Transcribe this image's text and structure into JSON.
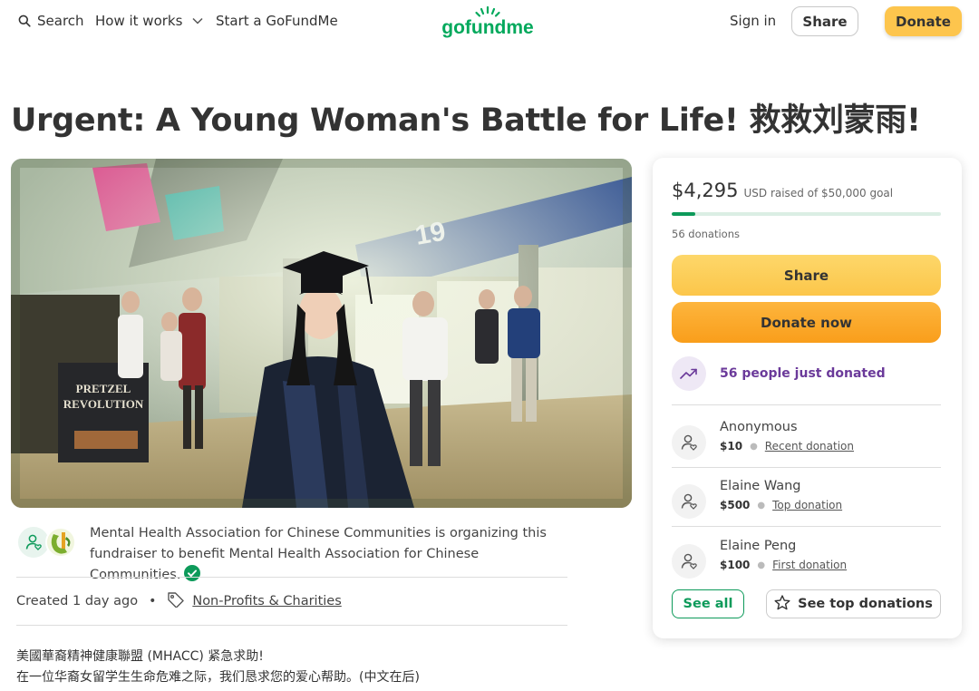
{
  "header": {
    "search_label": "Search",
    "how_it_works_label": "How it works",
    "start_label": "Start a GoFundMe",
    "logo_text": "gofundme",
    "sign_in_label": "Sign in",
    "share_label": "Share",
    "donate_label": "Donate"
  },
  "campaign": {
    "title": "Urgent: A Young Woman's Battle for Life! 救救刘蒙雨!",
    "hero_sign_line1": "PRETZEL",
    "hero_sign_line2": "REVOLUTION",
    "hero_banner_number": "19",
    "organizer_text": "Mental Health Association for Chinese Communities is organizing this fundraiser to benefit Mental Health Association for Chinese Communities.",
    "created_label": "Created 1 day ago",
    "category_label": "Non-Profits & Charities",
    "description_line1": "美國華裔精神健康聯盟 (MHACC) 紧急求助!",
    "description_line2": "在一位华裔女留学生生命危难之际，我们恳求您的爱心帮助。(中文在后)"
  },
  "donation_card": {
    "raised_amount": "$4,295",
    "raised_text": "USD raised of $50,000 goal",
    "progress_fraction": 0.0859,
    "donations_count": "56 donations",
    "share_label": "Share",
    "donate_label": "Donate now",
    "trending_text": "56 people just donated",
    "donors": [
      {
        "name": "Anonymous",
        "amount": "$10",
        "tag": "Recent donation"
      },
      {
        "name": "Elaine Wang",
        "amount": "$500",
        "tag": "Top donation"
      },
      {
        "name": "Elaine Peng",
        "amount": "$100",
        "tag": "First donation"
      }
    ],
    "see_all_label": "See all",
    "see_top_label": "See top donations"
  },
  "colors": {
    "brand_green": "#0d9a5a",
    "donate_yellow": "#fdc54d",
    "donate_orange": "#f99e1b",
    "trend_purple": "#6b3a9a"
  }
}
